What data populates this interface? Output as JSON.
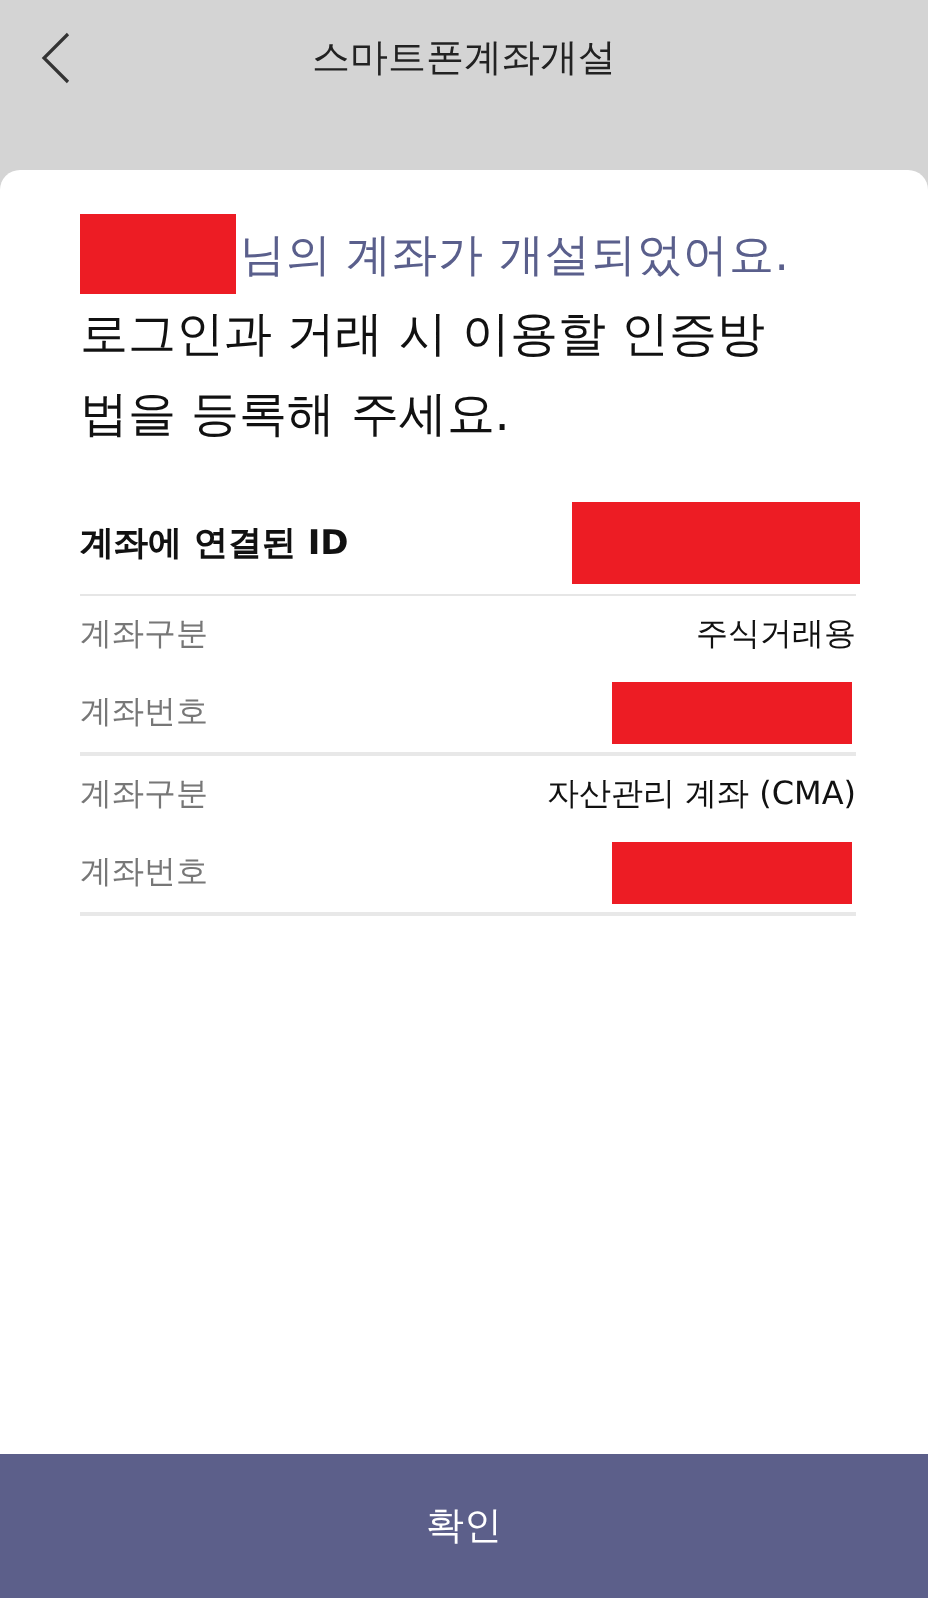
{
  "header": {
    "title": "스마트폰계좌개설"
  },
  "greeting": {
    "name_redacted": true,
    "suffix": "님의 계좌가 개설되었어요."
  },
  "instruction": "로그인과 거래 시 이용할 인증방법을 등록해 주세요.",
  "linked_id": {
    "label": "계좌에 연결된 ID",
    "kind": "redacted"
  },
  "accounts": [
    {
      "rows": [
        {
          "label": "계좌구분",
          "kind": "text",
          "value": "주식거래용"
        },
        {
          "label": "계좌번호",
          "kind": "redacted"
        }
      ]
    },
    {
      "rows": [
        {
          "label": "계좌구분",
          "kind": "text",
          "value": "자산관리 계좌 (CMA)"
        },
        {
          "label": "계좌번호",
          "kind": "redacted"
        }
      ]
    }
  ],
  "confirm_button": {
    "label": "확인"
  }
}
